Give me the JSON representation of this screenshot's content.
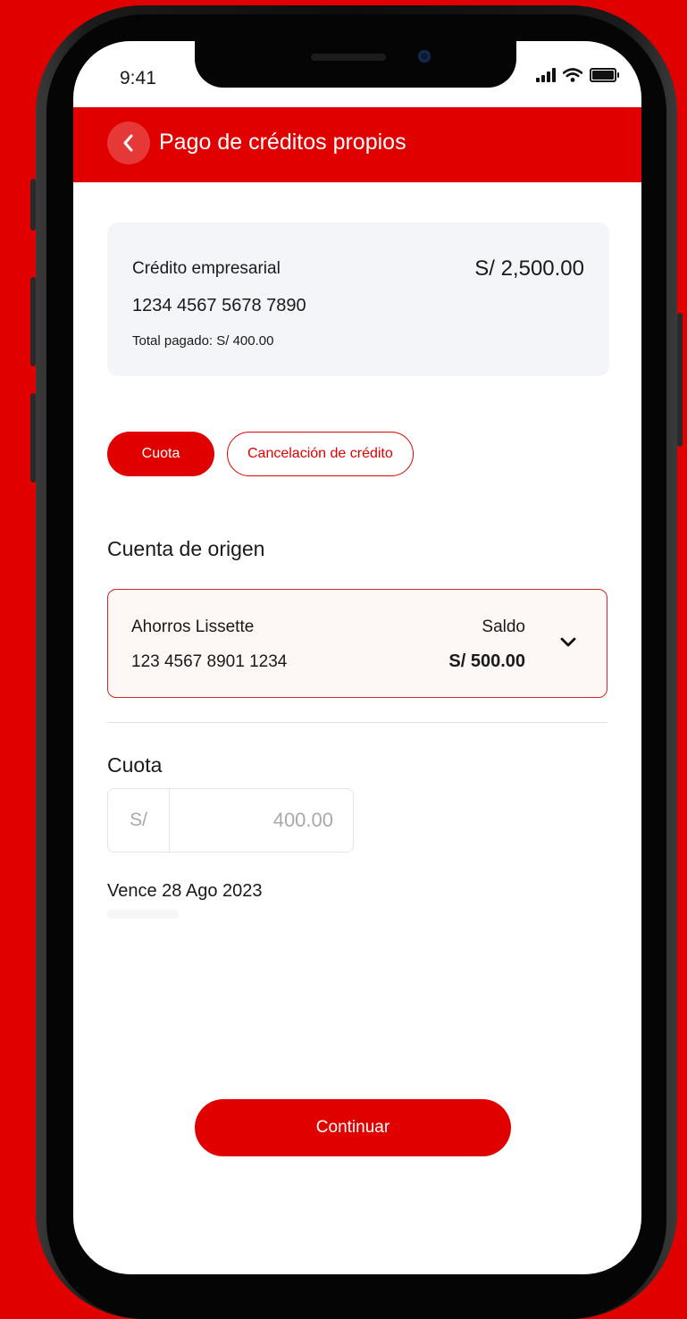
{
  "status": {
    "time": "9:41"
  },
  "header": {
    "title": "Pago de créditos propios"
  },
  "credit": {
    "name": "Crédito empresarial",
    "number": "1234 4567 5678 7890",
    "total_paid": "Total pagado: S/ 400.00",
    "amount": "S/ 2,500.00"
  },
  "tabs": [
    {
      "label": "Cuota",
      "active": true
    },
    {
      "label": "Cancelación de crédito",
      "active": false
    }
  ],
  "origin": {
    "title": "Cuenta de origen",
    "account_name": "Ahorros Lissette",
    "account_number": "123 4567 8901 1234",
    "balance_label": "Saldo",
    "balance": "S/ 500.00"
  },
  "payment": {
    "title": "Cuota",
    "currency": "S/",
    "amount": "400.00",
    "due": "Vence 28 Ago 2023"
  },
  "actions": {
    "continue_label": "Continuar"
  },
  "colors": {
    "brand": "#e00000",
    "background": "#e00000"
  }
}
